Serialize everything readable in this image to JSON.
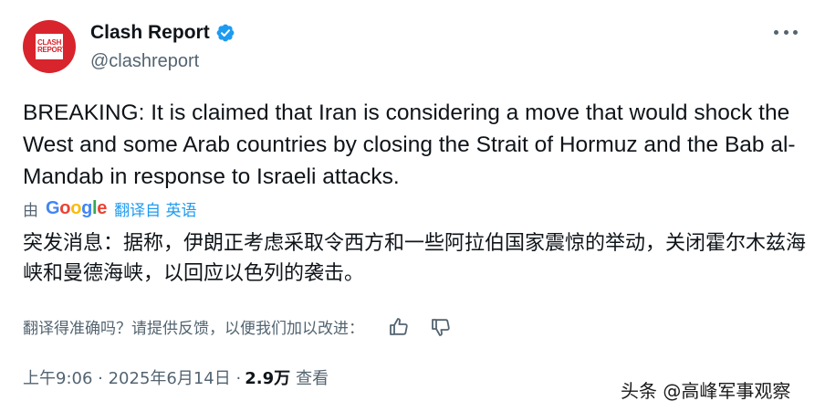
{
  "author": {
    "avatar_text": "CLASH REPORT",
    "display_name": "Clash Report",
    "verified_icon": "verified-badge-icon",
    "handle": "@clashreport"
  },
  "more_icon": "more-options-icon",
  "tweet": {
    "text": "BREAKING: It is claimed that Iran is considering a move that would shock the West and some Arab countries by closing the Strait of Hormuz and the Bab al-Mandab in response to Israeli attacks."
  },
  "translation": {
    "by_label": "由",
    "provider": "Google",
    "link_text": "翻译自 英语",
    "text": "突发消息：据称，伊朗正考虑采取令西方和一些阿拉伯国家震惊的举动，关闭霍尔木兹海峡和曼德海峡，以回应以色列的袭击。",
    "feedback_prompt": "翻译得准确吗？请提供反馈，以便我们加以改进：",
    "thumbs_up_icon": "thumbs-up-icon",
    "thumbs_down_icon": "thumbs-down-icon"
  },
  "meta": {
    "timestamp": "上午9:06 · 2025年6月14日 ·",
    "views_count": "2.9万",
    "views_label": "查看"
  },
  "watermark": "头条 @高峰军事观察",
  "colors": {
    "brand_red": "#d8242c",
    "verified_blue": "#1d9bf0",
    "text_primary": "#0f1419",
    "text_secondary": "#536471"
  }
}
